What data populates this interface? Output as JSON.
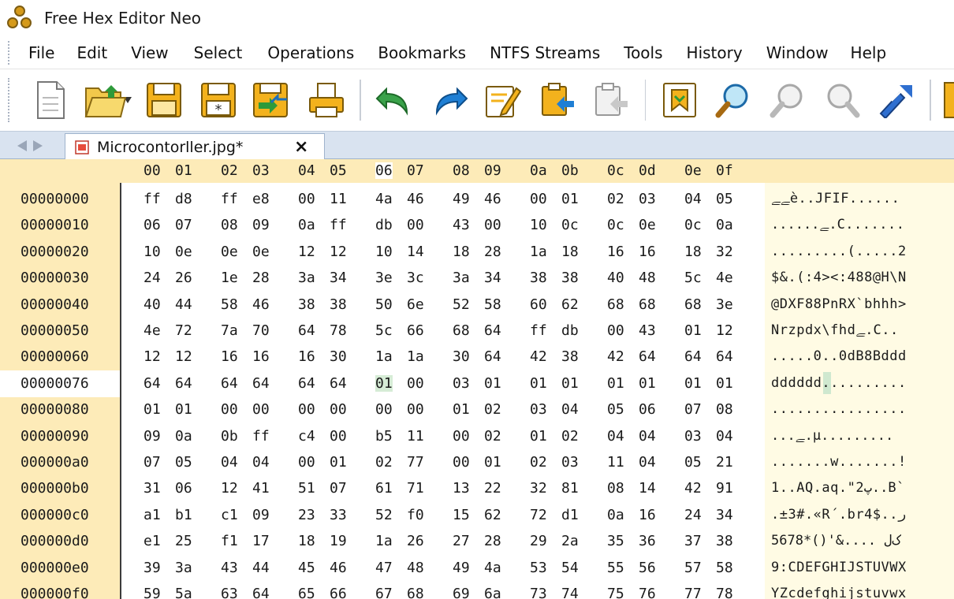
{
  "title": "Free Hex Editor Neo",
  "menu": [
    "File",
    "Edit",
    "View",
    "Select",
    "Operations",
    "Bookmarks",
    "NTFS Streams",
    "Tools",
    "History",
    "Window",
    "Help"
  ],
  "toolbar": {
    "icons": [
      "new-file-icon",
      "open-file-icon",
      "open-dropdown-icon",
      "save-icon",
      "save-as-icon",
      "save-all-icon",
      "print-icon",
      "undo-icon",
      "redo-icon",
      "edit-icon",
      "paste-icon",
      "paste-special-icon",
      "bookmark-icon",
      "find-icon",
      "find-next-icon",
      "find-previous-icon",
      "tools-icon"
    ]
  },
  "tab": {
    "label": "Microcontorller.jpg*",
    "close": "×"
  },
  "columns": [
    "00",
    "01",
    "02",
    "03",
    "04",
    "05",
    "06",
    "07",
    "08",
    "09",
    "0a",
    "0b",
    "0c",
    "0d",
    "0e",
    "0f"
  ],
  "active_column": "06",
  "rows": [
    {
      "addr": "00000000",
      "bytes": [
        "ff",
        "d8",
        "ff",
        "e8",
        "00",
        "11",
        "4a",
        "46",
        "49",
        "46",
        "00",
        "01",
        "02",
        "03",
        "04",
        "05"
      ],
      "ascii": "ﮯﮯè..JFIF......"
    },
    {
      "addr": "00000010",
      "bytes": [
        "06",
        "07",
        "08",
        "09",
        "0a",
        "ff",
        "db",
        "00",
        "43",
        "00",
        "10",
        "0c",
        "0c",
        "0e",
        "0c",
        "0a"
      ],
      "ascii": "......ﮯ.C......."
    },
    {
      "addr": "00000020",
      "bytes": [
        "10",
        "0e",
        "0e",
        "0e",
        "12",
        "12",
        "10",
        "14",
        "18",
        "28",
        "1a",
        "18",
        "16",
        "16",
        "18",
        "32"
      ],
      "ascii": ".........(.....2"
    },
    {
      "addr": "00000030",
      "bytes": [
        "24",
        "26",
        "1e",
        "28",
        "3a",
        "34",
        "3e",
        "3c",
        "3a",
        "34",
        "38",
        "38",
        "40",
        "48",
        "5c",
        "4e"
      ],
      "ascii": "$&.(:4><:488@H\\N"
    },
    {
      "addr": "00000040",
      "bytes": [
        "40",
        "44",
        "58",
        "46",
        "38",
        "38",
        "50",
        "6e",
        "52",
        "58",
        "60",
        "62",
        "68",
        "68",
        "68",
        "3e"
      ],
      "ascii": "@DXF88PnRX`bhhh>"
    },
    {
      "addr": "00000050",
      "bytes": [
        "4e",
        "72",
        "7a",
        "70",
        "64",
        "78",
        "5c",
        "66",
        "68",
        "64",
        "ff",
        "db",
        "00",
        "43",
        "01",
        "12"
      ],
      "ascii": "Nrzpdx\\fhdﮯ.C.."
    },
    {
      "addr": "00000060",
      "bytes": [
        "12",
        "12",
        "16",
        "16",
        "16",
        "30",
        "1a",
        "1a",
        "30",
        "64",
        "42",
        "38",
        "42",
        "64",
        "64",
        "64"
      ],
      "ascii": ".....0..0dB8Bddd"
    },
    {
      "addr": "00000076",
      "bytes": [
        "64",
        "64",
        "64",
        "64",
        "64",
        "64",
        "01",
        "00",
        "03",
        "01",
        "01",
        "01",
        "01",
        "01",
        "01",
        "01"
      ],
      "ascii": "dddddd.........."
    },
    {
      "addr": "00000080",
      "bytes": [
        "01",
        "01",
        "00",
        "00",
        "00",
        "00",
        "00",
        "00",
        "01",
        "02",
        "03",
        "04",
        "05",
        "06",
        "07",
        "08"
      ],
      "ascii": "................"
    },
    {
      "addr": "00000090",
      "bytes": [
        "09",
        "0a",
        "0b",
        "ff",
        "c4",
        "00",
        "b5",
        "11",
        "00",
        "02",
        "01",
        "02",
        "04",
        "04",
        "03",
        "04"
      ],
      "ascii": "...ﮯ.µ........."
    },
    {
      "addr": "000000a0",
      "bytes": [
        "07",
        "05",
        "04",
        "04",
        "00",
        "01",
        "02",
        "77",
        "00",
        "01",
        "02",
        "03",
        "11",
        "04",
        "05",
        "21"
      ],
      "ascii": ".......w.......!"
    },
    {
      "addr": "000000b0",
      "bytes": [
        "31",
        "06",
        "12",
        "41",
        "51",
        "07",
        "61",
        "71",
        "13",
        "22",
        "32",
        "81",
        "08",
        "14",
        "42",
        "91"
      ],
      "ascii": "1..AQ.aq.\"ﭖ2..B`"
    },
    {
      "addr": "000000c0",
      "bytes": [
        "a1",
        "b1",
        "c1",
        "09",
        "23",
        "33",
        "52",
        "f0",
        "15",
        "62",
        "72",
        "d1",
        "0a",
        "16",
        "24",
        "34"
      ],
      "ascii": ".±3#.«R΄.br4$..ر"
    },
    {
      "addr": "000000d0",
      "bytes": [
        "e1",
        "25",
        "f1",
        "17",
        "18",
        "19",
        "1a",
        "26",
        "27",
        "28",
        "29",
        "2a",
        "35",
        "36",
        "37",
        "38"
      ],
      "ascii": "5678*()'&.... ﮎل"
    },
    {
      "addr": "000000e0",
      "bytes": [
        "39",
        "3a",
        "43",
        "44",
        "45",
        "46",
        "47",
        "48",
        "49",
        "4a",
        "53",
        "54",
        "55",
        "56",
        "57",
        "58"
      ],
      "ascii": "9:CDEFGHIJSTUVWX"
    },
    {
      "addr": "000000f0",
      "bytes": [
        "59",
        "5a",
        "63",
        "64",
        "65",
        "66",
        "67",
        "68",
        "69",
        "6a",
        "73",
        "74",
        "75",
        "76",
        "77",
        "78"
      ],
      "ascii": "YZcdefghijstuvwx"
    }
  ],
  "current_row_index": 7,
  "selected_byte_index": 6,
  "colors": {
    "gutter": "#fdebb8",
    "ascii_bg": "#fffbe4",
    "selection": "#d6ecd6",
    "tabstrip": "#d9e3f0"
  }
}
